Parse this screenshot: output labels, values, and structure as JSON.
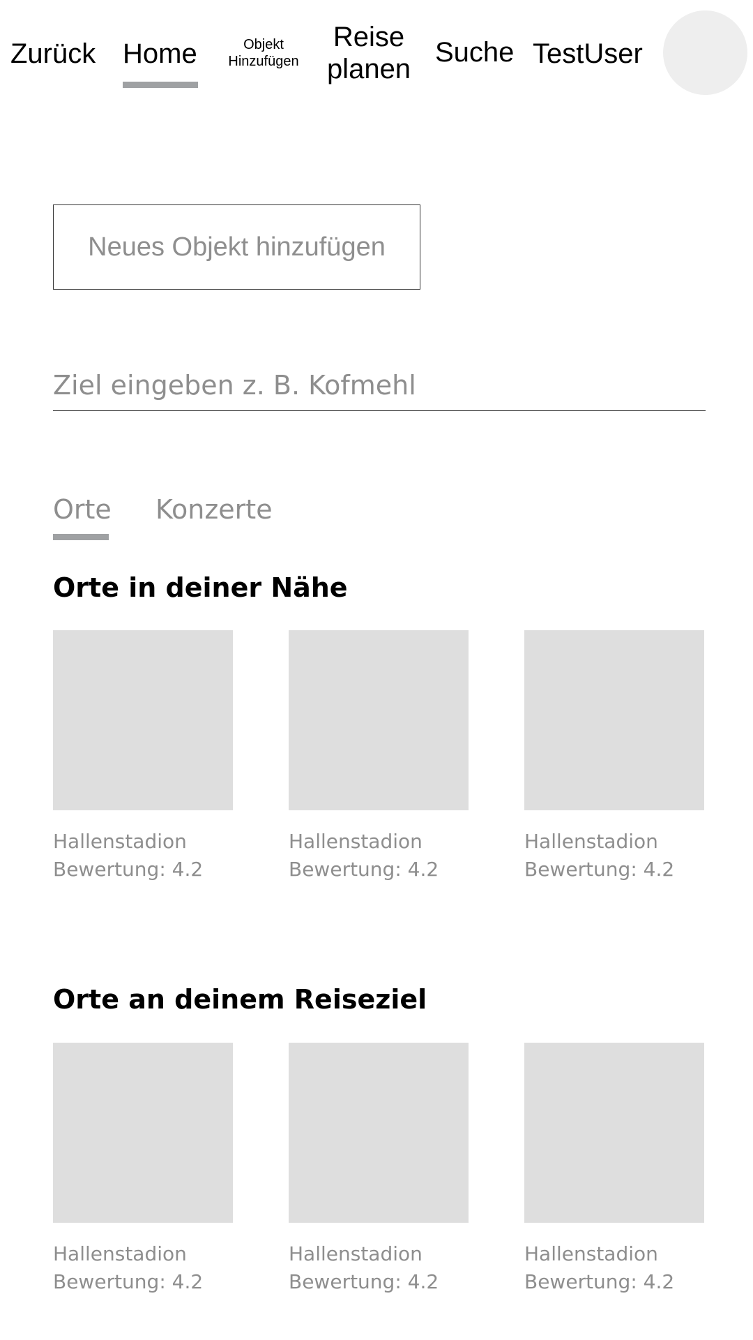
{
  "nav": {
    "back_label": "Zurück",
    "home_label": "Home",
    "add_line1": "Objekt",
    "add_line2": "Hinzufügen",
    "trip_line1": "Reise",
    "trip_line2": "planen",
    "search_label": "Suche",
    "user_label": "TestUser",
    "active_item": "Home"
  },
  "add_object": {
    "label": "Neues Objekt hinzufügen"
  },
  "destination": {
    "placeholder": "Ziel eingeben z. B. Kofmehl",
    "value": ""
  },
  "tabs": [
    {
      "label": "Orte",
      "active": true
    },
    {
      "label": "Konzerte",
      "active": false
    }
  ],
  "sections": {
    "nearby": {
      "title": "Orte in deiner Nähe",
      "cards": [
        {
          "name": "Hallenstadion",
          "rating": "Bewertung: 4.2"
        },
        {
          "name": "Hallenstadion",
          "rating": "Bewertung: 4.2"
        },
        {
          "name": "Hallenstadion",
          "rating": "Bewertung: 4.2"
        }
      ]
    },
    "destination": {
      "title": "Orte an deinem Reiseziel",
      "cards": [
        {
          "name": "Hallenstadion",
          "rating": "Bewertung: 4.2"
        },
        {
          "name": "Hallenstadion",
          "rating": "Bewertung: 4.2"
        },
        {
          "name": "Hallenstadion",
          "rating": "Bewertung: 4.2"
        }
      ]
    }
  },
  "colors": {
    "placeholder_gray": "#8e8e8e",
    "underline_gray": "#9fa1a3",
    "thumb_gray": "#dedede",
    "avatar_gray": "#eeeeee"
  }
}
